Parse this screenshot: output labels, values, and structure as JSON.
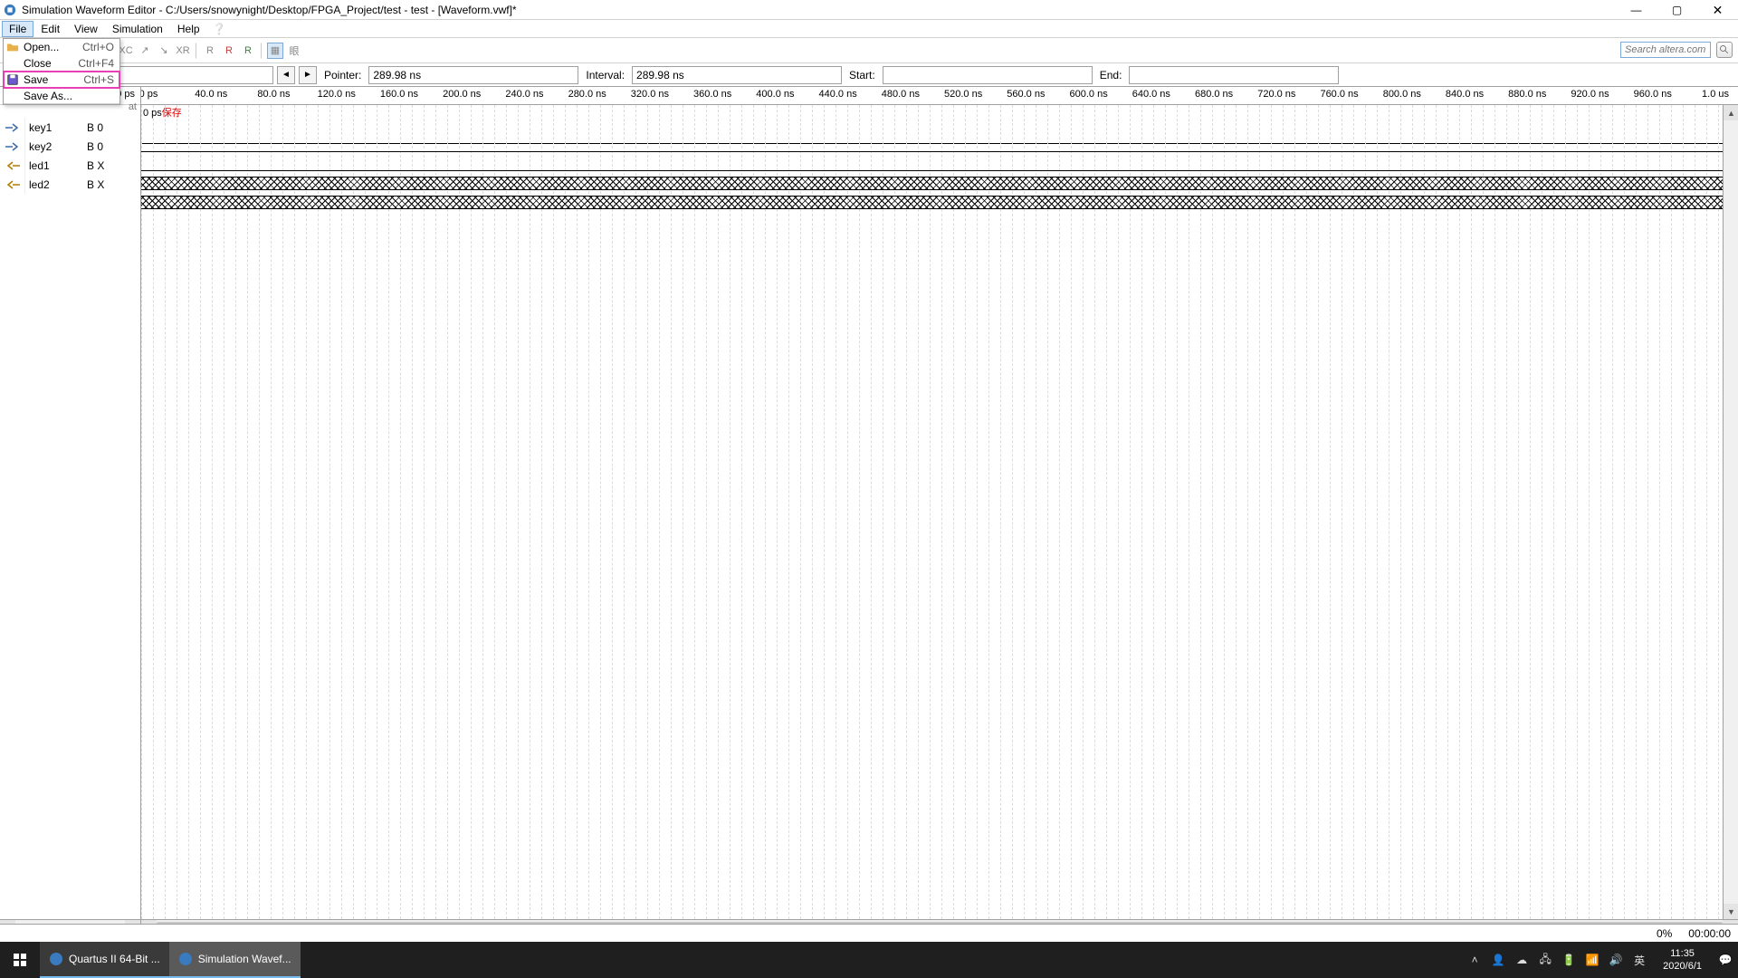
{
  "title": "Simulation Waveform Editor - C:/Users/snowynight/Desktop/FPGA_Project/test - test - [Waveform.vwf]*",
  "menus": [
    "File",
    "Edit",
    "View",
    "Simulation",
    "Help"
  ],
  "dropdown": {
    "items": [
      {
        "label": "Open...",
        "shortcut": "Ctrl+O",
        "icon": "folder"
      },
      {
        "label": "Close",
        "shortcut": "Ctrl+F4",
        "sep": true
      },
      {
        "label": "Save",
        "shortcut": "Ctrl+S",
        "icon": "disk",
        "highlight": true
      },
      {
        "label": "Save As...",
        "sep": true
      }
    ]
  },
  "search_placeholder": "Search altera.com",
  "left_head": "0 ps",
  "end_tail": "at",
  "info": {
    "pointer_label": "Pointer:",
    "pointer_value": "289.98 ns",
    "interval_label": "Interval:",
    "interval_value": "289.98 ns",
    "start_label": "Start:",
    "start_value": "",
    "end_label": "End:",
    "end_value": ""
  },
  "annot_prefix": "0 ps",
  "annot_red": "保存",
  "signals": [
    {
      "name": "key1",
      "value": "B 0",
      "type": "in",
      "wave": "low"
    },
    {
      "name": "key2",
      "value": "B 0",
      "type": "in",
      "wave": "low"
    },
    {
      "name": "led1",
      "value": "B X",
      "type": "out",
      "wave": "x"
    },
    {
      "name": "led2",
      "value": "B X",
      "type": "out",
      "wave": "x"
    }
  ],
  "ruler_ticks": [
    "0 ps",
    "40.0 ns",
    "80.0 ns",
    "120.0 ns",
    "160.0 ns",
    "200.0 ns",
    "240.0 ns",
    "280.0 ns",
    "320.0 ns",
    "360.0 ns",
    "400.0 ns",
    "440.0 ns",
    "480.0 ns",
    "520.0 ns",
    "560.0 ns",
    "600.0 ns",
    "640.0 ns",
    "680.0 ns",
    "720.0 ns",
    "760.0 ns",
    "800.0 ns",
    "840.0 ns",
    "880.0 ns",
    "920.0 ns",
    "960.0 ns",
    "1.0 us"
  ],
  "status": {
    "percent": "0%",
    "time": "00:00:00"
  },
  "taskbar": {
    "apps": [
      {
        "label": "Quartus II 64-Bit ..."
      },
      {
        "label": "Simulation Wavef...",
        "active": true
      }
    ],
    "ime": "英",
    "clock_time": "11:35",
    "clock_date": "2020/6/1"
  }
}
